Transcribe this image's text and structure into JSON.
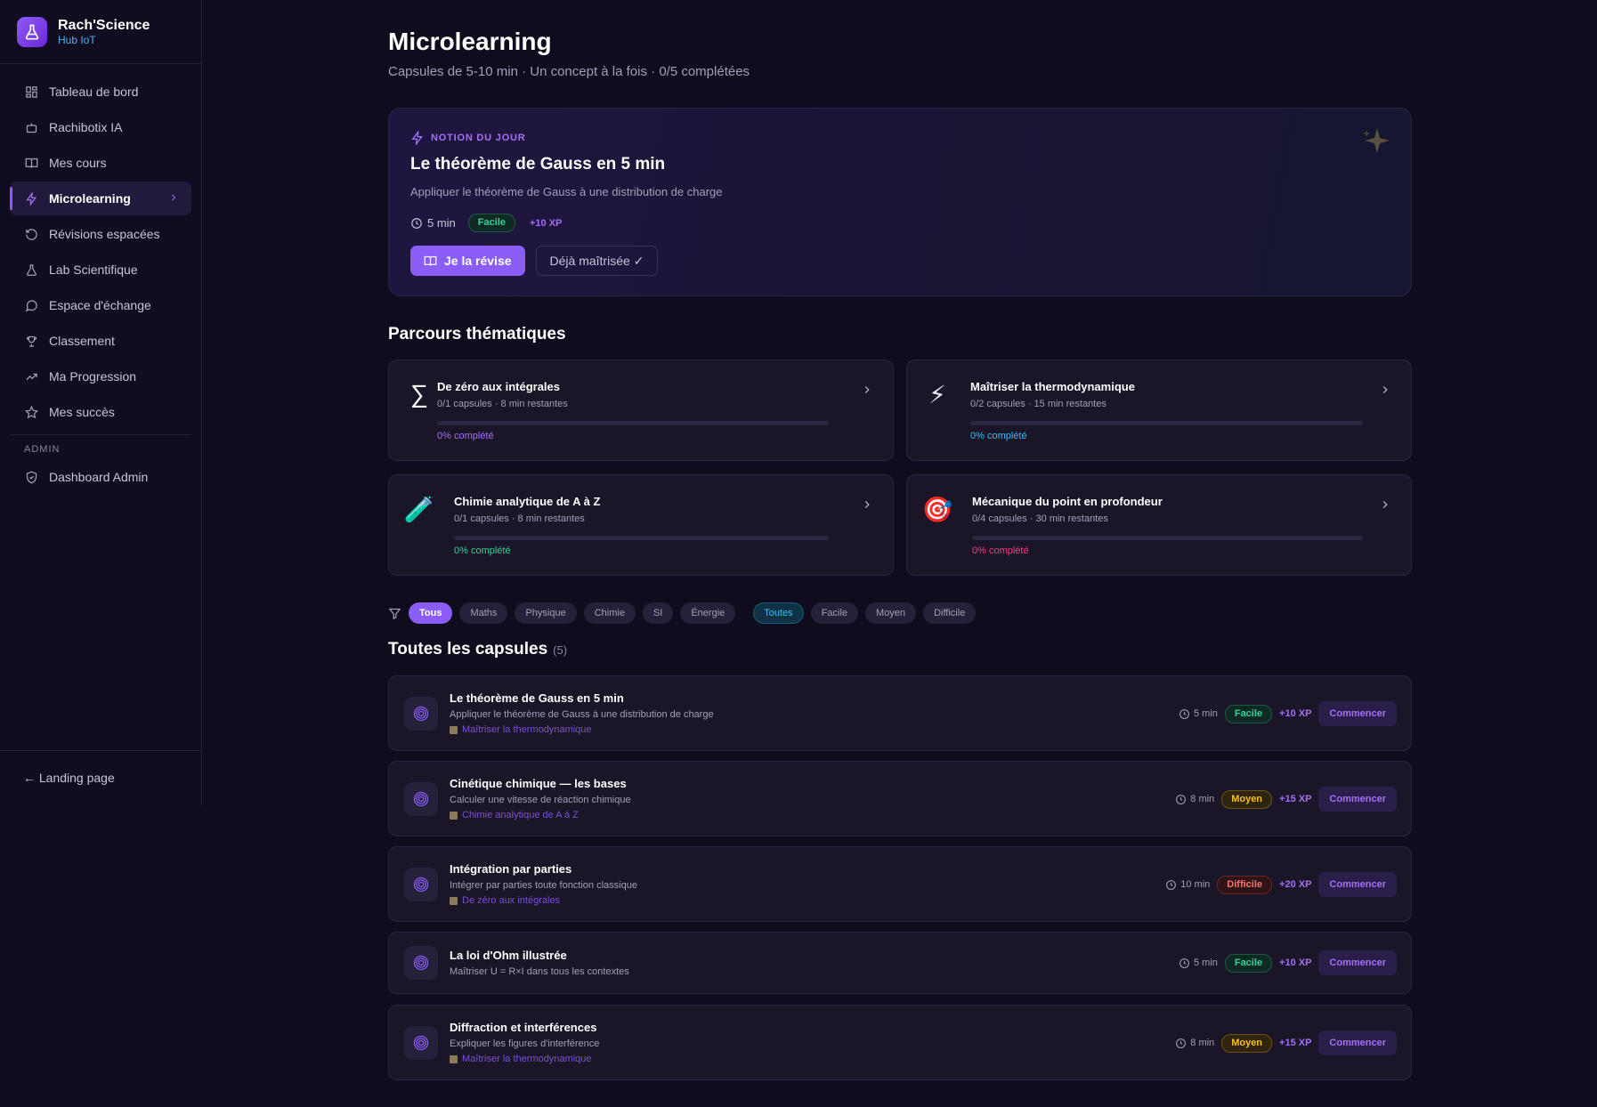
{
  "brand": {
    "title": "Rach'Science",
    "subtitle": "Hub IoT"
  },
  "nav": {
    "items": [
      {
        "label": "Tableau de bord",
        "icon": "grid-icon"
      },
      {
        "label": "Rachibotix IA",
        "icon": "bot-icon"
      },
      {
        "label": "Mes cours",
        "icon": "book-icon"
      },
      {
        "label": "Microlearning",
        "icon": "lightning-icon",
        "active": true
      },
      {
        "label": "Révisions espacées",
        "icon": "refresh-icon"
      },
      {
        "label": "Lab Scientifique",
        "icon": "flask-icon"
      },
      {
        "label": "Espace d'échange",
        "icon": "chat-icon"
      },
      {
        "label": "Classement",
        "icon": "trophy-icon"
      },
      {
        "label": "Ma Progression",
        "icon": "trend-icon"
      },
      {
        "label": "Mes succès",
        "icon": "star-icon"
      }
    ],
    "admin_section": "ADMIN",
    "admin_item": "Dashboard Admin",
    "landing": "← Landing page"
  },
  "page": {
    "title": "Microlearning",
    "subtitle": "Capsules de 5-10 min · Un concept à la fois · 0/5 complétées"
  },
  "hero": {
    "kicker": "NOTION DU JOUR",
    "title": "Le théorème de Gauss en 5 min",
    "description": "Appliquer le théorème de Gauss à une distribution de charge",
    "time": "5 min",
    "difficulty": "Facile",
    "xp": "+10 XP",
    "primary_label": "Je la révise",
    "secondary_label": "Déjà maîtrisée ✓"
  },
  "tracks_section": {
    "title": "Parcours thématiques"
  },
  "tracks": [
    {
      "emoji": "∑",
      "title": "De zéro aux intégrales",
      "sub": "0/1 capsules · 8 min restantes",
      "pct_label": "0% complété",
      "progress": 0,
      "color": "#a56ef7"
    },
    {
      "emoji": "⚡",
      "title": "Maîtriser la thermodynamique",
      "sub": "0/2 capsules · 15 min restantes",
      "pct_label": "0% complété",
      "progress": 0,
      "color": "#38bdf8"
    },
    {
      "emoji": "🧪",
      "title": "Chimie analytique de A à Z",
      "sub": "0/1 capsules · 8 min restantes",
      "pct_label": "0% complété",
      "progress": 0,
      "color": "#34d399"
    },
    {
      "emoji": "🎯",
      "title": "Mécanique du point en profondeur",
      "sub": "0/4 capsules · 30 min restantes",
      "pct_label": "0% complété",
      "progress": 0,
      "color": "#f43f7e"
    }
  ],
  "filters": {
    "subjects": [
      "Tous",
      "Maths",
      "Physique",
      "Chimie",
      "SI",
      "Énergie"
    ],
    "difficulties": [
      "Toutes",
      "Facile",
      "Moyen",
      "Difficile"
    ]
  },
  "capsules_section": {
    "title": "Toutes les capsules",
    "count": "(5)"
  },
  "capsules": [
    {
      "title": "Le théorème de Gauss en 5 min",
      "description": "Appliquer le théorème de Gauss à une distribution de charge",
      "track": "Maîtriser la thermodynamique",
      "time": "5 min",
      "difficulty": "Facile",
      "level": "easy",
      "xp": "+10 XP",
      "action": "Commencer"
    },
    {
      "title": "Cinétique chimique — les bases",
      "description": "Calculer une vitesse de réaction chimique",
      "track": "Chimie analytique de A à Z",
      "time": "8 min",
      "difficulty": "Moyen",
      "level": "medium",
      "xp": "+15 XP",
      "action": "Commencer"
    },
    {
      "title": "Intégration par parties",
      "description": "Intégrer par parties toute fonction classique",
      "track": "De zéro aux intégrales",
      "time": "10 min",
      "difficulty": "Difficile",
      "level": "hard",
      "xp": "+20 XP",
      "action": "Commencer"
    },
    {
      "title": "La loi d'Ohm illustrée",
      "description": "Maîtriser U = R×I dans tous les contextes",
      "track": "",
      "time": "5 min",
      "difficulty": "Facile",
      "level": "easy",
      "xp": "+10 XP",
      "action": "Commencer"
    },
    {
      "title": "Diffraction et interférences",
      "description": "Expliquer les figures d'interférence",
      "track": "Maîtriser la thermodynamique",
      "time": "8 min",
      "difficulty": "Moyen",
      "level": "medium",
      "xp": "+15 XP",
      "action": "Commencer"
    }
  ],
  "colors": {
    "accent": "#8b5cf6",
    "background": "#0f0c1d",
    "card": "#1a1628"
  }
}
